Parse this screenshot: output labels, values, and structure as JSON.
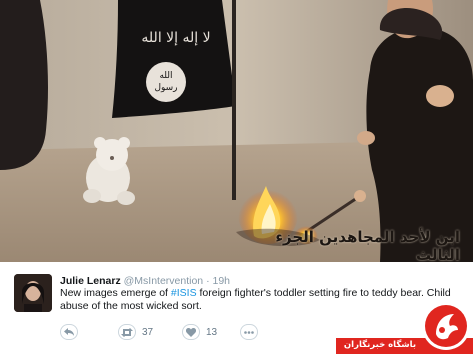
{
  "photo": {
    "caption_ar": "ابن لأحد المجاهدين الجزء الثالث"
  },
  "tweet": {
    "author_name": "Julie Lenarz",
    "author_handle": "@MsIntervention",
    "dot": "·",
    "time": "19h",
    "text_before": "New images emerge of ",
    "hashtag": "#ISIS",
    "text_after": " foreign fighter's toddler setting fire to teddy bear. Child abuse of the most wicked sort.",
    "actions": {
      "reply_icon": "reply-arrow-icon",
      "retweet_icon": "retweet-icon",
      "retweet_count": "37",
      "like_icon": "heart-icon",
      "like_count": "13",
      "more_icon": "more-dots-icon"
    },
    "colors": {
      "link": "#1b95e0",
      "muted": "#8899a6"
    }
  },
  "watermark": {
    "label_fa": "باشگاه خبرنگاران",
    "color": "#e0261f"
  }
}
